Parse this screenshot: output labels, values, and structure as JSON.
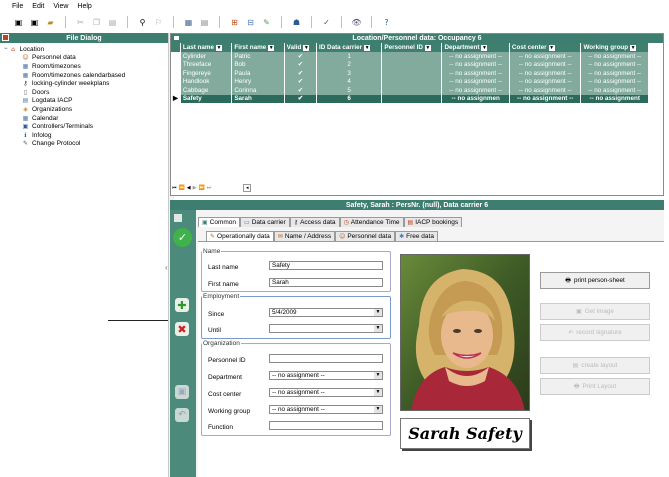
{
  "menu": [
    "File",
    "Edit",
    "View",
    "Help"
  ],
  "file_dialog": {
    "title": "File Dialog",
    "tree": [
      {
        "label": "Location",
        "icon": "location-icon",
        "indent": 0
      },
      {
        "label": "Personnel data",
        "icon": "person-icon",
        "indent": 1
      },
      {
        "label": "Room/timezones",
        "icon": "room-icon",
        "indent": 1
      },
      {
        "label": "Room/timezones calendarbased",
        "icon": "room-icon",
        "indent": 1
      },
      {
        "label": "locking-cylinder weekplans",
        "icon": "key-icon",
        "indent": 1
      },
      {
        "label": "Doors",
        "icon": "door-icon",
        "indent": 1
      },
      {
        "label": "Logdata IACP",
        "icon": "log-icon",
        "indent": 1
      },
      {
        "label": "Organizations",
        "icon": "org-icon",
        "indent": 1
      },
      {
        "label": "Calendar",
        "icon": "calendar-icon",
        "indent": 1
      },
      {
        "label": "Controllers/Terminals",
        "icon": "controller-icon",
        "indent": 1
      },
      {
        "label": "Infolog",
        "icon": "info-icon",
        "indent": 1
      },
      {
        "label": "Change Protocol",
        "icon": "protocol-icon",
        "indent": 1
      }
    ]
  },
  "grid": {
    "title": "Location/Personnel data: Occupancy 6",
    "columns": [
      "Last name",
      "First name",
      "Valid",
      "ID Data carrier",
      "Personnel ID",
      "Department",
      "Cost center",
      "Working group"
    ],
    "rows": [
      {
        "last": "Cylinder",
        "first": "Patric",
        "valid": "✔",
        "carrier": "1",
        "pid": "",
        "dept": "-- no assignment --",
        "cost": "-- no assignment --",
        "group": "-- no assignment --"
      },
      {
        "last": "Threeface",
        "first": "Bob",
        "valid": "✔",
        "carrier": "2",
        "pid": "",
        "dept": "-- no assignment --",
        "cost": "-- no assignment --",
        "group": "-- no assignment --"
      },
      {
        "last": "Fingereye",
        "first": "Paula",
        "valid": "✔",
        "carrier": "3",
        "pid": "",
        "dept": "-- no assignment --",
        "cost": "-- no assignment --",
        "group": "-- no assignment --"
      },
      {
        "last": "Handlook",
        "first": "Henry",
        "valid": "✔",
        "carrier": "4",
        "pid": "",
        "dept": "-- no assignment --",
        "cost": "-- no assignment --",
        "group": "-- no assignment --"
      },
      {
        "last": "Cabbage",
        "first": "Corinna",
        "valid": "✔",
        "carrier": "5",
        "pid": "",
        "dept": "-- no assignment --",
        "cost": "-- no assignment --",
        "group": "-- no assignment --"
      },
      {
        "last": "Safety",
        "first": "Sarah",
        "valid": "✔",
        "carrier": "6",
        "pid": "",
        "dept": "-- no assignmen",
        "cost": "-- no assignment --",
        "group": "-- no assignment"
      }
    ],
    "selected_index": 5
  },
  "detail": {
    "title": "Safety, Sarah : PersNr. (null), Data carrier 6",
    "tabs_row1": [
      {
        "label": "Common",
        "icon": "common-icon",
        "active": true
      },
      {
        "label": "Data carrier",
        "icon": "card-icon",
        "active": false
      },
      {
        "label": "Access data",
        "icon": "key-icon",
        "active": false
      },
      {
        "label": "Attendance Time",
        "icon": "clock-icon",
        "active": false
      },
      {
        "label": "IACP bookings",
        "icon": "booking-icon",
        "active": false
      }
    ],
    "tabs_row2": [
      {
        "label": "Operationally data",
        "icon": "ops-icon",
        "active": true
      },
      {
        "label": "Name / Address",
        "icon": "address-icon",
        "active": false
      },
      {
        "label": "Personnel data",
        "icon": "person-icon",
        "active": false
      },
      {
        "label": "Free data",
        "icon": "free-icon",
        "active": false
      }
    ],
    "name_group": {
      "legend": "Name",
      "last_name_label": "Last name",
      "last_name": "Safety",
      "first_name_label": "First name",
      "first_name": "Sarah"
    },
    "employment_group": {
      "legend": "Employment",
      "since_label": "Since",
      "since": "5/4/2009",
      "until_label": "Until",
      "until": ""
    },
    "organization_group": {
      "legend": "Organization",
      "pid_label": "Personnel ID",
      "pid": "",
      "dept_label": "Department",
      "dept": "-- no assignment --",
      "cost_label": "Cost center",
      "cost": "-- no assignment --",
      "group_label": "Working group",
      "group": "-- no assignment --",
      "function_label": "Function",
      "function": ""
    },
    "signature_text": "Sarah Safety",
    "buttons": {
      "print_sheet": "print person-sheet",
      "get_image": "Get image",
      "record_signature": "record signature",
      "create_layout": "create layout",
      "print_layout": "Print Layout"
    }
  },
  "colors": {
    "teal": "#3e7e70",
    "row": "#82ab9e",
    "selected": "#2c6a5c"
  }
}
